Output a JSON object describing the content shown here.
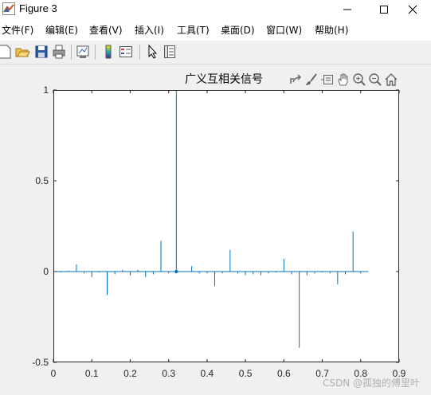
{
  "window": {
    "title": "Figure 3"
  },
  "menu": [
    {
      "label": "文件(F)"
    },
    {
      "label": "编辑(E)"
    },
    {
      "label": "查看(V)"
    },
    {
      "label": "插入(I)"
    },
    {
      "label": "工具(T)"
    },
    {
      "label": "桌面(D)"
    },
    {
      "label": "窗口(W)"
    },
    {
      "label": "帮助(H)"
    }
  ],
  "toolbar": {
    "icons": [
      "new-figure-icon",
      "open-file-icon",
      "save-icon",
      "print-icon",
      "link-plot-icon",
      "insert-colorbar-icon",
      "insert-legend-icon",
      "edit-plot-icon",
      "property-inspector-icon"
    ]
  },
  "axes_toolbar": {
    "icons": [
      "export-icon",
      "brush-icon",
      "data-tips-icon",
      "pan-icon",
      "zoom-in-icon",
      "zoom-out-icon",
      "home-icon"
    ]
  },
  "watermark": "CSDN @孤独的傅里叶",
  "colors": {
    "series": "#0072bd",
    "axes_bg": "#ffffff",
    "figure_bg": "#f0f0f0",
    "axis": "#262626"
  },
  "chart_data": {
    "type": "line",
    "title": "广义互相关信号",
    "xlabel": "",
    "ylabel": "",
    "xlim": [
      0,
      0.9
    ],
    "ylim": [
      -0.5,
      1
    ],
    "xticks": [
      "0",
      "0.1",
      "0.2",
      "0.3",
      "0.4",
      "0.5",
      "0.6",
      "0.7",
      "0.8",
      "0.9"
    ],
    "yticks": [
      "-0.5",
      "0",
      "0.5",
      "1"
    ],
    "grid": false,
    "legend": "none",
    "series": [
      {
        "x": [
          0.0,
          0.02,
          0.04,
          0.06,
          0.08,
          0.1,
          0.12,
          0.14,
          0.16,
          0.18,
          0.2,
          0.22,
          0.24,
          0.26,
          0.28,
          0.3,
          0.32,
          0.34,
          0.36,
          0.38,
          0.4,
          0.42,
          0.44,
          0.46,
          0.48,
          0.5,
          0.52,
          0.54,
          0.56,
          0.58,
          0.6,
          0.62,
          0.64,
          0.66,
          0.68,
          0.7,
          0.72,
          0.74,
          0.76,
          0.78,
          0.8,
          0.82
        ],
        "y": [
          0.0,
          -0.005,
          0.005,
          0.04,
          -0.01,
          -0.03,
          -0.005,
          -0.13,
          -0.015,
          0.01,
          -0.02,
          0.01,
          -0.03,
          -0.015,
          0.17,
          -0.01,
          1.0,
          0.0,
          0.03,
          -0.01,
          -0.01,
          -0.08,
          -0.01,
          0.12,
          -0.01,
          -0.02,
          -0.015,
          -0.02,
          -0.01,
          -0.005,
          0.07,
          -0.015,
          -0.42,
          -0.02,
          -0.01,
          -0.005,
          -0.01,
          -0.07,
          -0.015,
          0.22,
          -0.01,
          0.0
        ]
      }
    ]
  }
}
